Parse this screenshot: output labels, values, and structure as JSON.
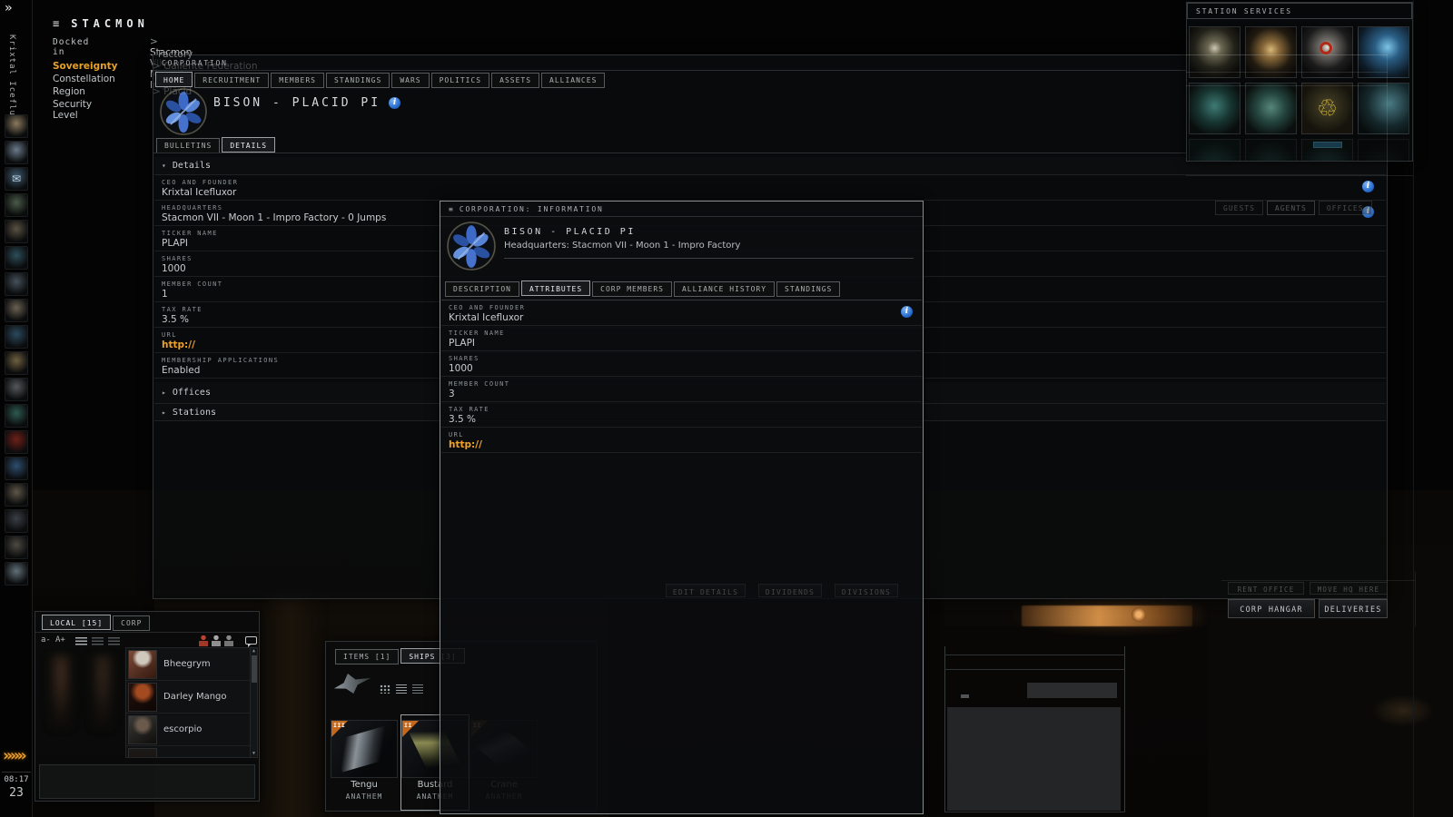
{
  "colors": {
    "accent": "#f0a227",
    "info_blue": "#2a6fd0"
  },
  "glyphs": {
    "menu": "≡",
    "arrow": ">",
    "expand": "»",
    "chevrons": "»»»",
    "tri_down": "▾",
    "tri_right": "▸",
    "up": "▲",
    "down": "▼",
    "info": "i",
    "mail": "✉",
    "recycle": "♲"
  },
  "neocom": {
    "character": "Krixtal Icefluxor",
    "clock": "08:17",
    "people_count": "23",
    "icons": [
      "character-sheet",
      "skills",
      "mail",
      "market",
      "wallet",
      "fitting",
      "inventory",
      "contracts",
      "star-map",
      "medals",
      "assets",
      "corp-wallet",
      "militia",
      "browser",
      "journal",
      "jukebox",
      "calculator",
      "ship-hangar"
    ]
  },
  "location": {
    "app_title": "STACMON",
    "docked_label": "Docked in",
    "station_line1": "Stacmon VII - Moon 1 - Impro",
    "station_line2": "Factory",
    "labels": [
      "Sovereignty",
      "Constellation",
      "Region",
      "Security Level"
    ],
    "sovereignty_value": "Gallente Federation",
    "region_value": "Placid"
  },
  "services": {
    "title": "STATION SERVICES",
    "icons": [
      "military",
      "ship-fitting",
      "bounty-office",
      "science-lab",
      "cloning",
      "storage-facilities",
      "reprocessing-plant",
      "repair-shop",
      "factories",
      "insurance",
      "security-office",
      "virtual-goods"
    ]
  },
  "corp": {
    "title": "CORPORATION",
    "tabs": [
      "HOME",
      "RECRUITMENT",
      "MEMBERS",
      "STANDINGS",
      "WARS",
      "POLITICS",
      "ASSETS",
      "ALLIANCES"
    ],
    "name": "BISON - PLACID PI",
    "subtabs": [
      "BULLETINS",
      "DETAILS"
    ],
    "section": "Details",
    "fields": [
      {
        "l": "CEO AND FOUNDER",
        "v": "Krixtal Icefluxor"
      },
      {
        "l": "HEADQUARTERS",
        "v": "Stacmon VII - Moon 1 - Impro Factory - 0 Jumps"
      },
      {
        "l": "TICKER NAME",
        "v": "PLAPI"
      },
      {
        "l": "SHARES",
        "v": "1000"
      },
      {
        "l": "MEMBER COUNT",
        "v": "1"
      },
      {
        "l": "TAX RATE",
        "v": "3.5 %"
      },
      {
        "l": "URL",
        "v": "http://"
      },
      {
        "l": "MEMBERSHIP APPLICATIONS",
        "v": "Enabled"
      }
    ],
    "sections_collapsed": [
      "Offices",
      "Stations"
    ],
    "ghost_buttons": [
      "EDIT DETAILS",
      "DIVIDENDS",
      "DIVISIONS"
    ],
    "ghost_tabs": [
      "GUESTS",
      "AGENTS",
      "OFFICES"
    ]
  },
  "infowin": {
    "title": "CORPORATION: INFORMATION",
    "name": "BISON - PLACID PI",
    "hq": "Headquarters: Stacmon VII - Moon 1 - Impro Factory",
    "tabs": [
      "DESCRIPTION",
      "ATTRIBUTES",
      "CORP MEMBERS",
      "ALLIANCE HISTORY",
      "STANDINGS"
    ],
    "fields": [
      {
        "l": "CEO AND FOUNDER",
        "v": "Krixtal Icefluxor"
      },
      {
        "l": "TICKER NAME",
        "v": "PLAPI"
      },
      {
        "l": "SHARES",
        "v": "1000"
      },
      {
        "l": "MEMBER COUNT",
        "v": "3"
      },
      {
        "l": "TAX RATE",
        "v": "3.5 %"
      },
      {
        "l": "URL",
        "v": "http://"
      }
    ]
  },
  "chat": {
    "tabs": [
      "LOCAL [15]",
      "CORP"
    ],
    "font_smaller": "a-",
    "font_larger": "A+",
    "members": [
      "Bheegrym",
      "Darley Mango",
      "escorpio"
    ],
    "toolbar_icons": [
      "list-view",
      "compact-view",
      "detail-view",
      "blocked-icon",
      "members-icon",
      "speakers-icon",
      "chat-bubble-icon"
    ]
  },
  "hangar": {
    "tabs": [
      "ITEMS [1]",
      "SHIPS [3]"
    ],
    "ships": [
      {
        "name": "Tengu",
        "owner": "ANATHEM",
        "tier": "III"
      },
      {
        "name": "Bustard",
        "owner": "ANATHEM",
        "tier": "II"
      },
      {
        "name": "Crane",
        "owner": "ANATHEM",
        "tier": "II"
      }
    ]
  },
  "station_panel": {
    "rent_office": "RENT OFFICE",
    "move_hq": "MOVE HQ HERE",
    "corp_hangar": "CORP HANGAR",
    "deliveries": "DELIVERIES"
  }
}
